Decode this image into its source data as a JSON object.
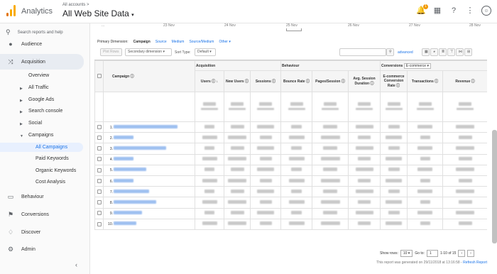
{
  "header": {
    "app_name": "Analytics",
    "breadcrumb": "All accounts >",
    "property": "All Web Site Data",
    "notification_count": "1"
  },
  "sidebar": {
    "search_placeholder": "Search reports and help",
    "items": [
      {
        "label": "Audience",
        "icon": "person-icon"
      },
      {
        "label": "Acquisition",
        "icon": "acquisition-icon"
      },
      {
        "label": "Behaviour",
        "icon": "behaviour-icon"
      },
      {
        "label": "Conversions",
        "icon": "flag-icon"
      },
      {
        "label": "Discover",
        "icon": "lightbulb-icon"
      },
      {
        "label": "Admin",
        "icon": "gear-icon"
      }
    ],
    "acq_sub": [
      "Overview",
      "All Traffic",
      "Google Ads",
      "Search console",
      "Social",
      "Campaigns"
    ],
    "campaign_sub": [
      "All Campaigns",
      "Paid Keywords",
      "Organic Keywords",
      "Cost Analysis"
    ]
  },
  "dates": [
    "...",
    "23 Nov",
    "24 Nov",
    "25 Nov",
    "26 Nov",
    "27 Nov",
    "28 Nov"
  ],
  "dims": {
    "label": "Primary Dimension:",
    "selected": "Campaign",
    "others": [
      "Source",
      "Medium",
      "Source/Medium",
      "Other"
    ]
  },
  "toolbar": {
    "plot_rows": "Plot Rows",
    "secondary": "Secondary dimension",
    "sort_label": "Sort Type:",
    "sort_value": "Default",
    "advanced": "advanced"
  },
  "table": {
    "campaign_header": "Campaign",
    "groups": [
      "Acquisition",
      "Behaviour",
      "Conversions"
    ],
    "conv_select": "E-commerce",
    "columns": [
      "Users",
      "New Users",
      "Sessions",
      "Bounce Rate",
      "Pages/Session",
      "Avg. Session Duration",
      "E-commerce Conversion Rate",
      "Transactions",
      "Revenue"
    ],
    "row_numbers": [
      "1.",
      "2.",
      "3.",
      "4.",
      "5.",
      "6.",
      "7.",
      "8.",
      "9.",
      "10."
    ]
  },
  "pager": {
    "show_rows": "Show rows:",
    "rows": "10",
    "goto": "Go to:",
    "page": "1",
    "range": "1-10 of 15"
  },
  "footer": {
    "generated": "This report was generated on 29/11/2018 at 13:16:58 -",
    "refresh": "Refresh Report"
  },
  "colors": {
    "accent": "#1a73e8",
    "logo_orange": "#f9ab00",
    "logo_dark": "#e37400"
  }
}
